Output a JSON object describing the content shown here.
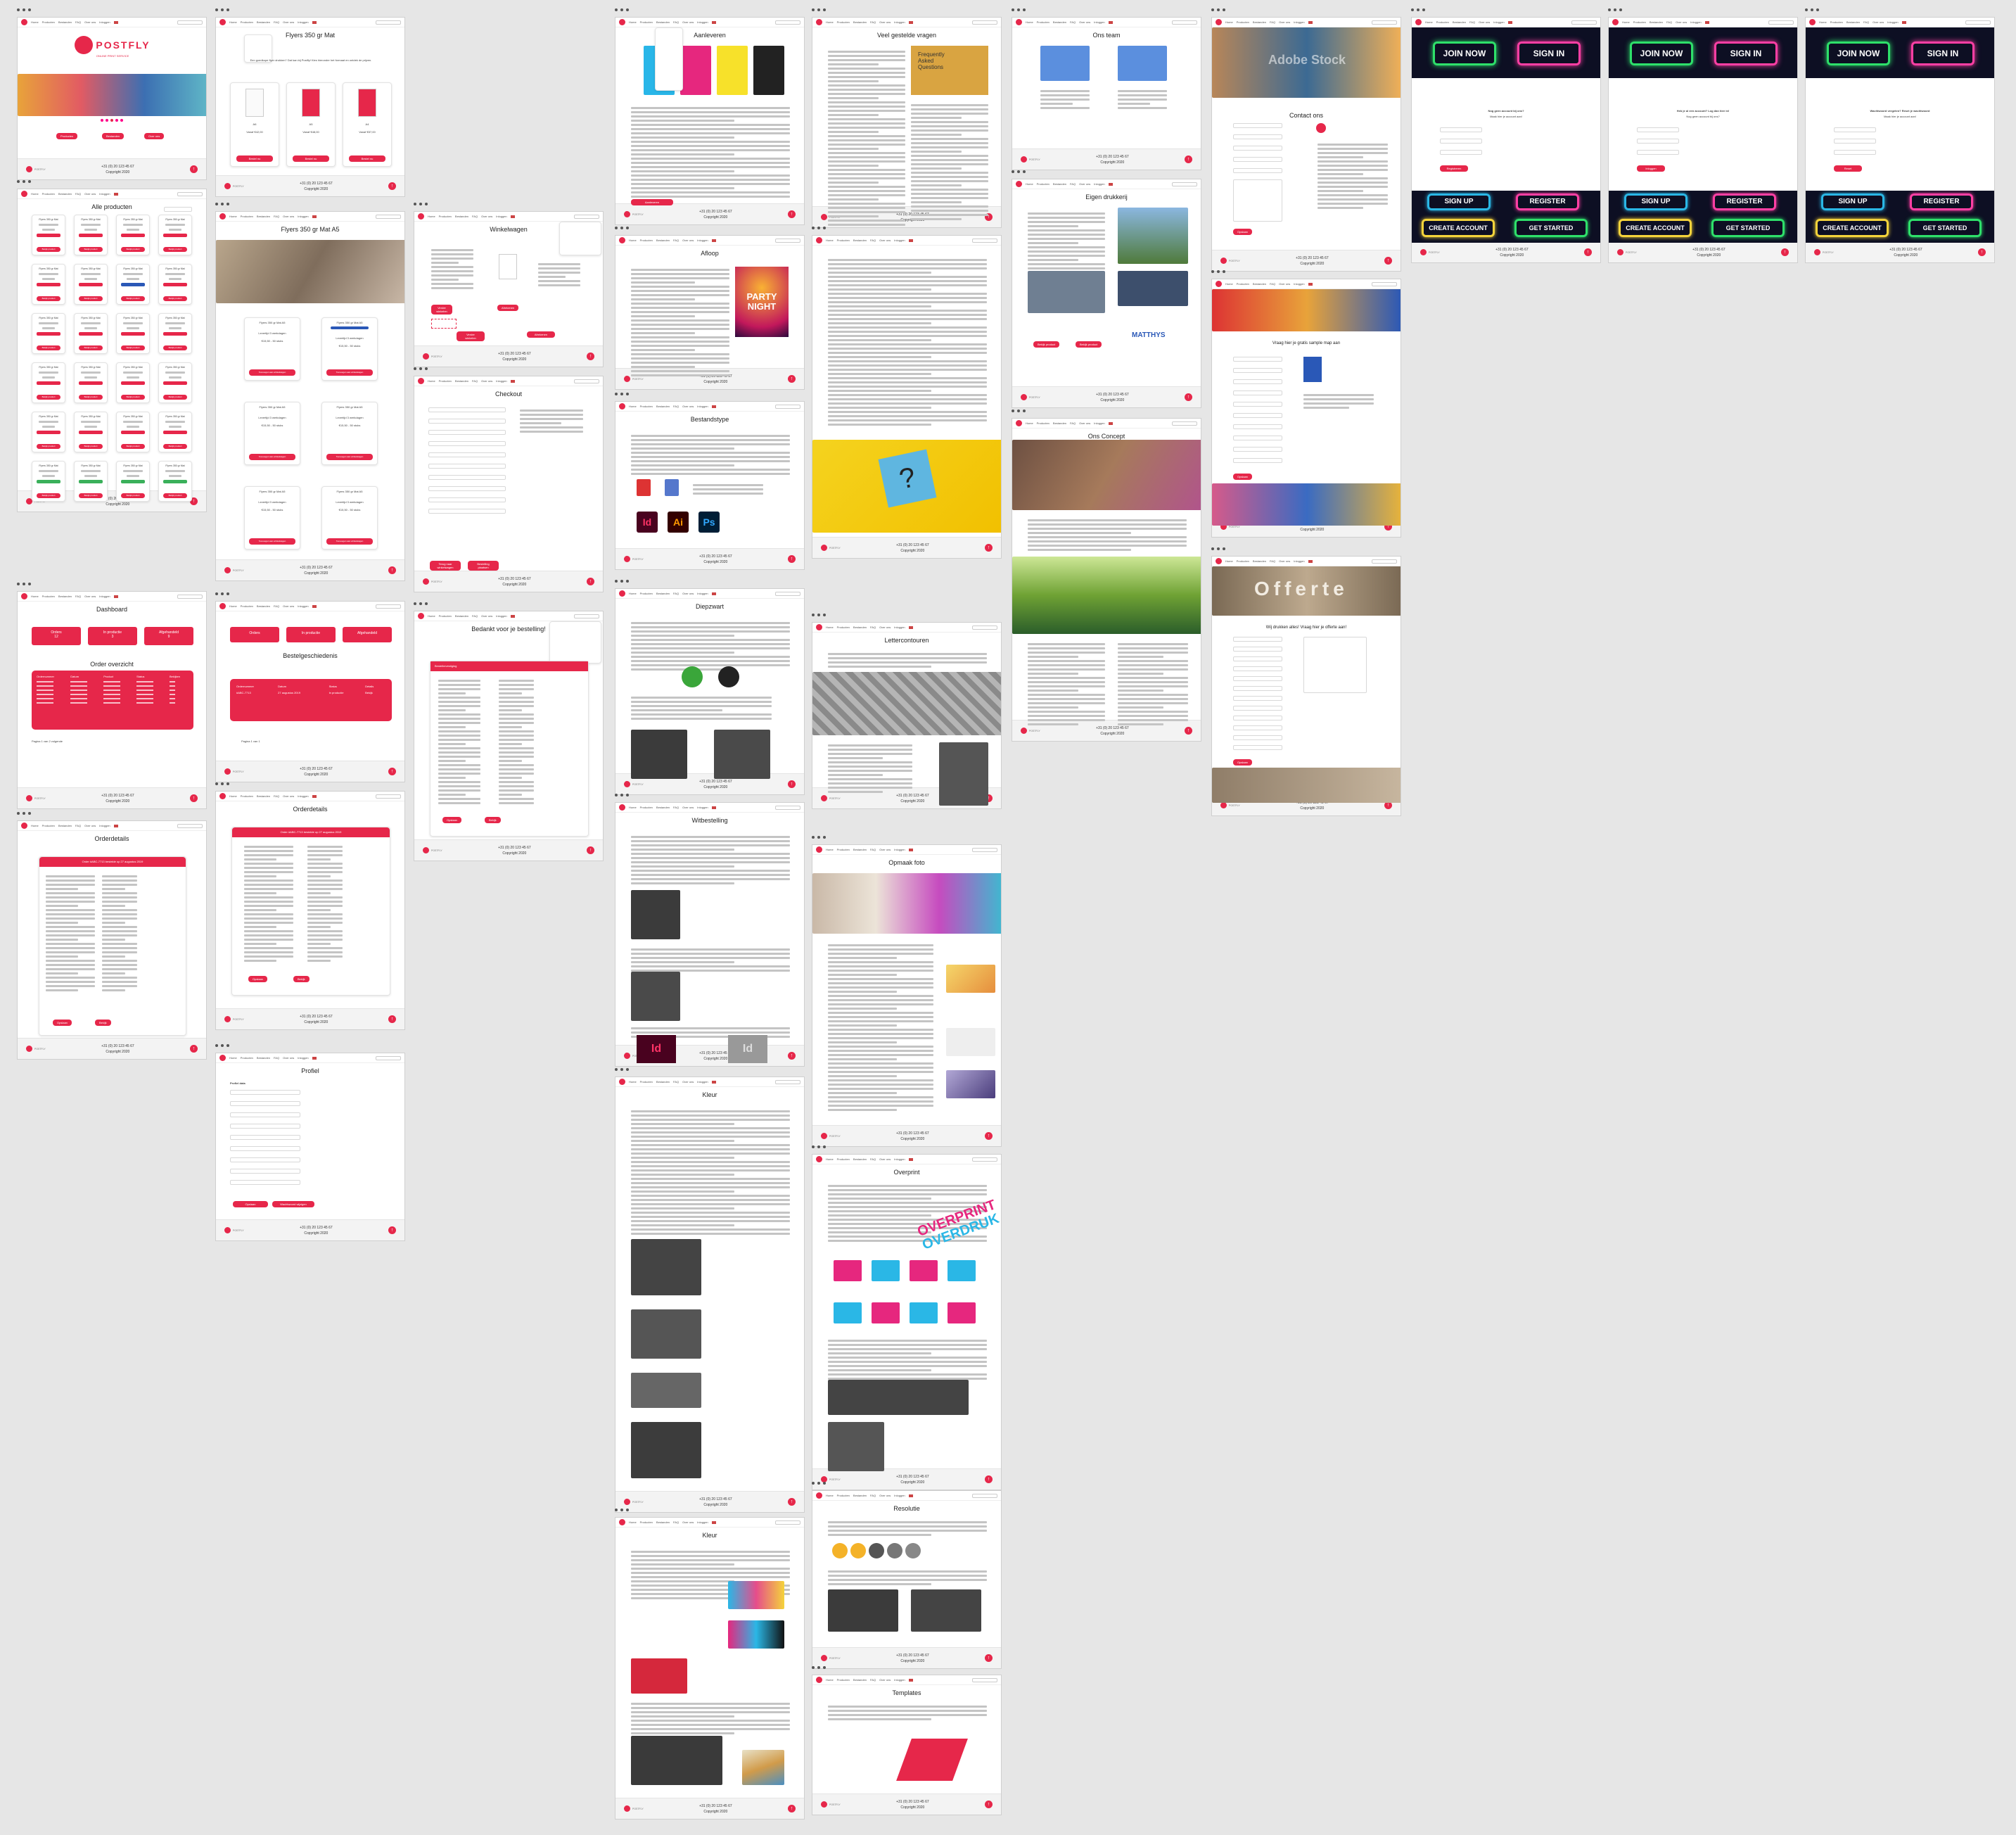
{
  "site": {
    "brand": "POSTFLY",
    "tagline": "ONLINE PRINT SERVICE",
    "nav": [
      "Home",
      "Producten",
      "Bestanden",
      "FAQ",
      "Over ons",
      "Inloggen"
    ],
    "phone": "+31 (0) 20 123 45 67",
    "footer_sub": "Copyright 2020",
    "to_top": "↑",
    "accent": "#e6274a"
  },
  "pages": {
    "alle_producten": {
      "title": "Alle producten",
      "card_title": "Flyers 350 gr Mat",
      "card_btn": "Bekijk product"
    },
    "flyers_product": {
      "title": "Flyers 350 gr Mat",
      "intro": "Een goedkope flyer drukken? Dat kan bij Postfly! Kies hieronder het formaat en ontdek de prijzen.",
      "formats": [
        "A6",
        "A5",
        "A4"
      ],
      "prices": [
        "Vanaf €42,00",
        "Vanaf €48,00",
        "Vanaf €57,00"
      ],
      "btn": "Bestel nu"
    },
    "flyers_a5": {
      "title": "Flyers 350 gr Mat A5",
      "card_titles": [
        "Flyers 350 gr Mat A5",
        "Flyers 350 gr Mat A5",
        "Flyers 350 gr Mat A5",
        "Flyers 350 gr Mat A5",
        "Flyers 350 gr Mat A5",
        "Flyers 350 gr Mat A5"
      ],
      "card_sub": "Levertijd 3 werkdagen",
      "price": "€15,50 - 50 stuks",
      "btn": "Toevoegen aan winkelwagen"
    },
    "winkelwagen": {
      "title": "Winkelwagen",
      "btn_left": "Verder winkelen",
      "btn_right": "Afrekenen"
    },
    "checkout": {
      "title": "Checkout",
      "btn_left": "Terug naar winkelwagen",
      "btn_right": "Bestelling plaatsen"
    },
    "bedankt": {
      "title": "Bedankt voor je bestelling!",
      "bar": "Bestelbevestiging"
    },
    "dashboard": {
      "title": "Dashboard",
      "tiles": [
        "Orders",
        "In productie",
        "Afgehandeld"
      ],
      "counts": [
        "12",
        "3",
        "9"
      ],
      "table_title": "Order overzicht",
      "headers": [
        "Ordernummer",
        "Datum",
        "Product",
        "Status",
        "Bekijken"
      ],
      "pager": "Pagina 1 van 2 volgende"
    },
    "bestelgeschiedenis": {
      "title": "Bestelgeschiedenis",
      "tiles": [
        "Orders",
        "In productie",
        "Afgehandeld"
      ],
      "headers": [
        "Ordernummer",
        "Datum",
        "Status",
        "Details"
      ],
      "row": [
        "#ABC-7713",
        "27 augustus 2019",
        "In productie",
        "Bekijk"
      ],
      "pager": "Pagina 1 van 1"
    },
    "orderdetails": {
      "title": "Orderdetails",
      "bar": "Order #ABC-7713 bestelde op 27 augustus 2019"
    },
    "profiel": {
      "title": "Profiel",
      "sub": "Profiel data",
      "btn_left": "Opslaan",
      "btn_right": "Wachtwoord wijzigen"
    },
    "aanleveren": {
      "title": "Aanleveren"
    },
    "aflopen": {
      "title": "Afloop",
      "poster1": "PARTY",
      "poster2": "NIGHT"
    },
    "bestandstype": {
      "title": "Bestandstype",
      "apps": [
        "Id",
        "Ai",
        "Ps"
      ]
    },
    "diepzwart": {
      "title": "Diepzwart"
    },
    "witbestelling": {
      "title": "Witbestelling",
      "apps": [
        "Id",
        "Id"
      ]
    },
    "afsnijtekens": {
      "title": "Afsnijtekens"
    },
    "kleur": {
      "title": "Kleur"
    },
    "faq": {
      "title": "Veel gestelde vragen",
      "sticky": [
        "Frequently",
        "Asked",
        "Questions"
      ]
    },
    "lettercontouren": {
      "title": "Lettercontouren"
    },
    "opmaak": {
      "title": "Opmaak foto"
    },
    "overprint": {
      "title": "Overprint",
      "words": [
        "OVERPRINT",
        "OVERDRUK"
      ]
    },
    "resolutie": {
      "title": "Resolutie"
    },
    "templates": {
      "title": "Templates"
    },
    "ons_team": {
      "title": "Ons team"
    },
    "eigen_drukkerij": {
      "title": "Eigen drukkerij",
      "partner": "MATTHYS"
    },
    "ons_concept": {
      "title": "Ons Concept"
    },
    "contact": {
      "title": "Contact ons",
      "watermark": "Adobe Stock"
    },
    "sample": {
      "title": "Vraag hier je gratis sample map aan"
    },
    "offerte": {
      "title": "Wij drukken alles! Vraag hier je offerte aan!",
      "hero": "Offerte"
    },
    "login": {
      "join": "JOIN NOW",
      "signin": "SIGN IN",
      "signup": "SIGN UP",
      "register": "REGISTER",
      "create": "CREATE ACCOUNT",
      "start": "GET STARTED",
      "q1": "Nog geen account bij ons?",
      "q2": "Maak hier je account aan!",
      "q3": "Heb je al een account? Log dan hier in!",
      "q4": "Wachtwoord vergeten? Reset je wachtwoord",
      "btn": "Inloggen",
      "btn2": "Registreren",
      "btn3": "Reset"
    }
  }
}
